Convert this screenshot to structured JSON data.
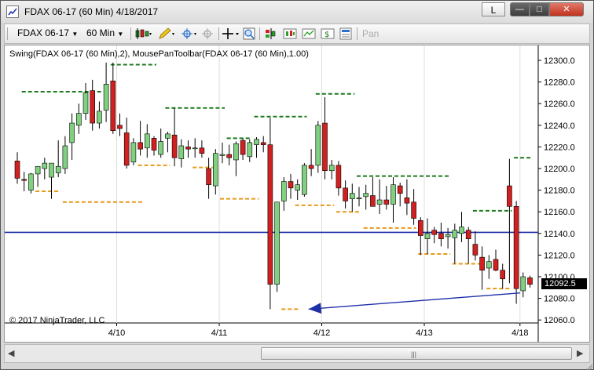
{
  "window": {
    "title": "FDAX 06-17 (60 Min)  4/18/2017",
    "l_button": "L",
    "controls": {
      "minimize": "—",
      "maximize": "□",
      "close": "✕"
    }
  },
  "toolbar": {
    "instrument": "FDAX 06-17",
    "interval": "60 Min",
    "pan_label": "Pan"
  },
  "chart": {
    "indicator_label": "Swing(FDAX 06-17 (60 Min),2), MousePanToolbar(FDAX 06-17 (60 Min),1.00)",
    "copyright": "© 2017 NinjaTrader, LLC",
    "last_price": "12092.5",
    "colors": {
      "up": "#7fd17f",
      "down": "#d21f1f",
      "swing_high": "#1c7a1c",
      "swing_low": "#e69a1a",
      "hline": "#1f2fa8",
      "arrow": "#1f2fa8"
    }
  },
  "chart_data": {
    "type": "candlestick",
    "instrument": "FDAX 06-17",
    "interval": "60 Min",
    "y_ticks": [
      12300,
      12280,
      12260,
      12240,
      12220,
      12200,
      12180,
      12160,
      12140,
      12120,
      12100,
      12080,
      12060
    ],
    "y_tick_labels": [
      "12300.0",
      "12280.0",
      "12260.0",
      "12240.0",
      "12220.0",
      "12200.0",
      "12180.0",
      "12160.0",
      "12140.0",
      "12120.0",
      "12100.0",
      "12080.0",
      "12060.0"
    ],
    "x_labels": [
      "4/10",
      "4/11",
      "4/12",
      "4/13",
      "4/18"
    ],
    "ylim": [
      12055,
      12308
    ],
    "horizontal_line": 12141,
    "candles": [
      {
        "o": 12207,
        "h": 12215,
        "l": 12186,
        "c": 12191
      },
      {
        "o": 12190,
        "h": 12197,
        "l": 12179,
        "c": 12189
      },
      {
        "o": 12180,
        "h": 12196,
        "l": 12177,
        "c": 12195
      },
      {
        "o": 12195,
        "h": 12202,
        "l": 12183,
        "c": 12202
      },
      {
        "o": 12200,
        "h": 12210,
        "l": 12190,
        "c": 12205
      },
      {
        "o": 12192,
        "h": 12204,
        "l": 12172,
        "c": 12205
      },
      {
        "o": 12196,
        "h": 12226,
        "l": 12192,
        "c": 12202
      },
      {
        "o": 12200,
        "h": 12230,
        "l": 12195,
        "c": 12221
      },
      {
        "o": 12224,
        "h": 12251,
        "l": 12208,
        "c": 12242
      },
      {
        "o": 12240,
        "h": 12260,
        "l": 12232,
        "c": 12251
      },
      {
        "o": 12251,
        "h": 12279,
        "l": 12245,
        "c": 12270
      },
      {
        "o": 12272,
        "h": 12282,
        "l": 12235,
        "c": 12242
      },
      {
        "o": 12242,
        "h": 12262,
        "l": 12237,
        "c": 12253
      },
      {
        "o": 12254,
        "h": 12298,
        "l": 12243,
        "c": 12278
      },
      {
        "o": 12281,
        "h": 12298,
        "l": 12232,
        "c": 12235
      },
      {
        "o": 12240,
        "h": 12251,
        "l": 12230,
        "c": 12237
      },
      {
        "o": 12233,
        "h": 12247,
        "l": 12200,
        "c": 12203
      },
      {
        "o": 12206,
        "h": 12228,
        "l": 12203,
        "c": 12224
      },
      {
        "o": 12224,
        "h": 12244,
        "l": 12212,
        "c": 12218
      },
      {
        "o": 12219,
        "h": 12241,
        "l": 12210,
        "c": 12232
      },
      {
        "o": 12228,
        "h": 12230,
        "l": 12212,
        "c": 12217
      },
      {
        "o": 12213,
        "h": 12237,
        "l": 12210,
        "c": 12225
      },
      {
        "o": 12228,
        "h": 12234,
        "l": 12215,
        "c": 12232
      },
      {
        "o": 12231,
        "h": 12256,
        "l": 12202,
        "c": 12210
      },
      {
        "o": 12209,
        "h": 12227,
        "l": 12201,
        "c": 12221
      },
      {
        "o": 12220,
        "h": 12226,
        "l": 12210,
        "c": 12218
      },
      {
        "o": 12219,
        "h": 12228,
        "l": 12210,
        "c": 12219
      },
      {
        "o": 12219,
        "h": 12226,
        "l": 12210,
        "c": 12214
      },
      {
        "o": 12200,
        "h": 12210,
        "l": 12172,
        "c": 12185
      },
      {
        "o": 12184,
        "h": 12218,
        "l": 12176,
        "c": 12214
      },
      {
        "o": 12212,
        "h": 12224,
        "l": 12205,
        "c": 12213
      },
      {
        "o": 12213,
        "h": 12222,
        "l": 12203,
        "c": 12210
      },
      {
        "o": 12208,
        "h": 12225,
        "l": 12193,
        "c": 12223
      },
      {
        "o": 12226,
        "h": 12228,
        "l": 12208,
        "c": 12213
      },
      {
        "o": 12211,
        "h": 12227,
        "l": 12206,
        "c": 12224
      },
      {
        "o": 12222,
        "h": 12229,
        "l": 12210,
        "c": 12227
      },
      {
        "o": 12224,
        "h": 12230,
        "l": 12215,
        "c": 12222
      },
      {
        "o": 12222,
        "h": 12247,
        "l": 12070,
        "c": 12093
      },
      {
        "o": 12093,
        "h": 12165,
        "l": 12086,
        "c": 12169
      },
      {
        "o": 12170,
        "h": 12192,
        "l": 12161,
        "c": 12188
      },
      {
        "o": 12188,
        "h": 12195,
        "l": 12172,
        "c": 12182
      },
      {
        "o": 12180,
        "h": 12190,
        "l": 12171,
        "c": 12185
      },
      {
        "o": 12176,
        "h": 12205,
        "l": 12174,
        "c": 12203
      },
      {
        "o": 12203,
        "h": 12218,
        "l": 12193,
        "c": 12200
      },
      {
        "o": 12203,
        "h": 12244,
        "l": 12196,
        "c": 12240
      },
      {
        "o": 12242,
        "h": 12266,
        "l": 12190,
        "c": 12198
      },
      {
        "o": 12198,
        "h": 12208,
        "l": 12190,
        "c": 12203
      },
      {
        "o": 12203,
        "h": 12207,
        "l": 12175,
        "c": 12182
      },
      {
        "o": 12182,
        "h": 12189,
        "l": 12163,
        "c": 12170
      },
      {
        "o": 12172,
        "h": 12186,
        "l": 12160,
        "c": 12177
      },
      {
        "o": 12172,
        "h": 12183,
        "l": 12165,
        "c": 12173
      },
      {
        "o": 12174,
        "h": 12185,
        "l": 12162,
        "c": 12177
      },
      {
        "o": 12175,
        "h": 12192,
        "l": 12165,
        "c": 12165
      },
      {
        "o": 12167,
        "h": 12190,
        "l": 12158,
        "c": 12171
      },
      {
        "o": 12171,
        "h": 12184,
        "l": 12162,
        "c": 12167
      },
      {
        "o": 12167,
        "h": 12192,
        "l": 12150,
        "c": 12185
      },
      {
        "o": 12184,
        "h": 12187,
        "l": 12165,
        "c": 12177
      },
      {
        "o": 12173,
        "h": 12190,
        "l": 12157,
        "c": 12168
      },
      {
        "o": 12169,
        "h": 12181,
        "l": 12148,
        "c": 12154
      },
      {
        "o": 12152,
        "h": 12155,
        "l": 12120,
        "c": 12138
      },
      {
        "o": 12135,
        "h": 12154,
        "l": 12121,
        "c": 12140
      },
      {
        "o": 12143,
        "h": 12146,
        "l": 12131,
        "c": 12139
      },
      {
        "o": 12140,
        "h": 12150,
        "l": 12128,
        "c": 12135
      },
      {
        "o": 12137,
        "h": 12145,
        "l": 12126,
        "c": 12139
      },
      {
        "o": 12136,
        "h": 12149,
        "l": 12112,
        "c": 12143
      },
      {
        "o": 12140,
        "h": 12160,
        "l": 12132,
        "c": 12146
      },
      {
        "o": 12143,
        "h": 12146,
        "l": 12112,
        "c": 12135
      },
      {
        "o": 12130,
        "h": 12142,
        "l": 12115,
        "c": 12120
      },
      {
        "o": 12118,
        "h": 12128,
        "l": 12088,
        "c": 12106
      },
      {
        "o": 12108,
        "h": 12120,
        "l": 12098,
        "c": 12114
      },
      {
        "o": 12116,
        "h": 12125,
        "l": 12105,
        "c": 12106
      },
      {
        "o": 12106,
        "h": 12112,
        "l": 12089,
        "c": 12098
      },
      {
        "o": 12184,
        "h": 12209,
        "l": 12094,
        "c": 12165
      },
      {
        "o": 12165,
        "h": 12170,
        "l": 12075,
        "c": 12089
      },
      {
        "o": 12087,
        "h": 12104,
        "l": 12081,
        "c": 12100
      },
      {
        "o": 12099,
        "h": 12101,
        "l": 12090,
        "c": 12093
      }
    ],
    "swing_highs": [
      {
        "start": 1,
        "end": 12,
        "value": 12271
      },
      {
        "start": 14,
        "end": 20,
        "value": 12296
      },
      {
        "start": 22,
        "end": 30,
        "value": 12256
      },
      {
        "start": 31,
        "end": 34,
        "value": 12228
      },
      {
        "start": 35,
        "end": 42,
        "value": 12248
      },
      {
        "start": 44,
        "end": 49,
        "value": 12269
      },
      {
        "start": 50,
        "end": 63,
        "value": 12193
      },
      {
        "start": 67,
        "end": 72,
        "value": 12161
      },
      {
        "start": 73,
        "end": 75,
        "value": 12210
      }
    ],
    "swing_lows": [
      {
        "start": 3,
        "end": 6,
        "value": 12179
      },
      {
        "start": 7,
        "end": 18,
        "value": 12169
      },
      {
        "start": 18,
        "end": 22,
        "value": 12203
      },
      {
        "start": 26,
        "end": 29,
        "value": 12201
      },
      {
        "start": 30,
        "end": 35,
        "value": 12172
      },
      {
        "start": 39,
        "end": 41,
        "value": 12070
      },
      {
        "start": 41,
        "end": 46,
        "value": 12166
      },
      {
        "start": 47,
        "end": 50,
        "value": 12160
      },
      {
        "start": 51,
        "end": 58,
        "value": 12145
      },
      {
        "start": 59,
        "end": 63,
        "value": 12121
      },
      {
        "start": 64,
        "end": 68,
        "value": 12112
      },
      {
        "start": 69,
        "end": 72,
        "value": 12089
      }
    ],
    "arrow": {
      "from_index": 73,
      "from_value": 12085,
      "to_index": 41,
      "to_value": 12070
    }
  }
}
